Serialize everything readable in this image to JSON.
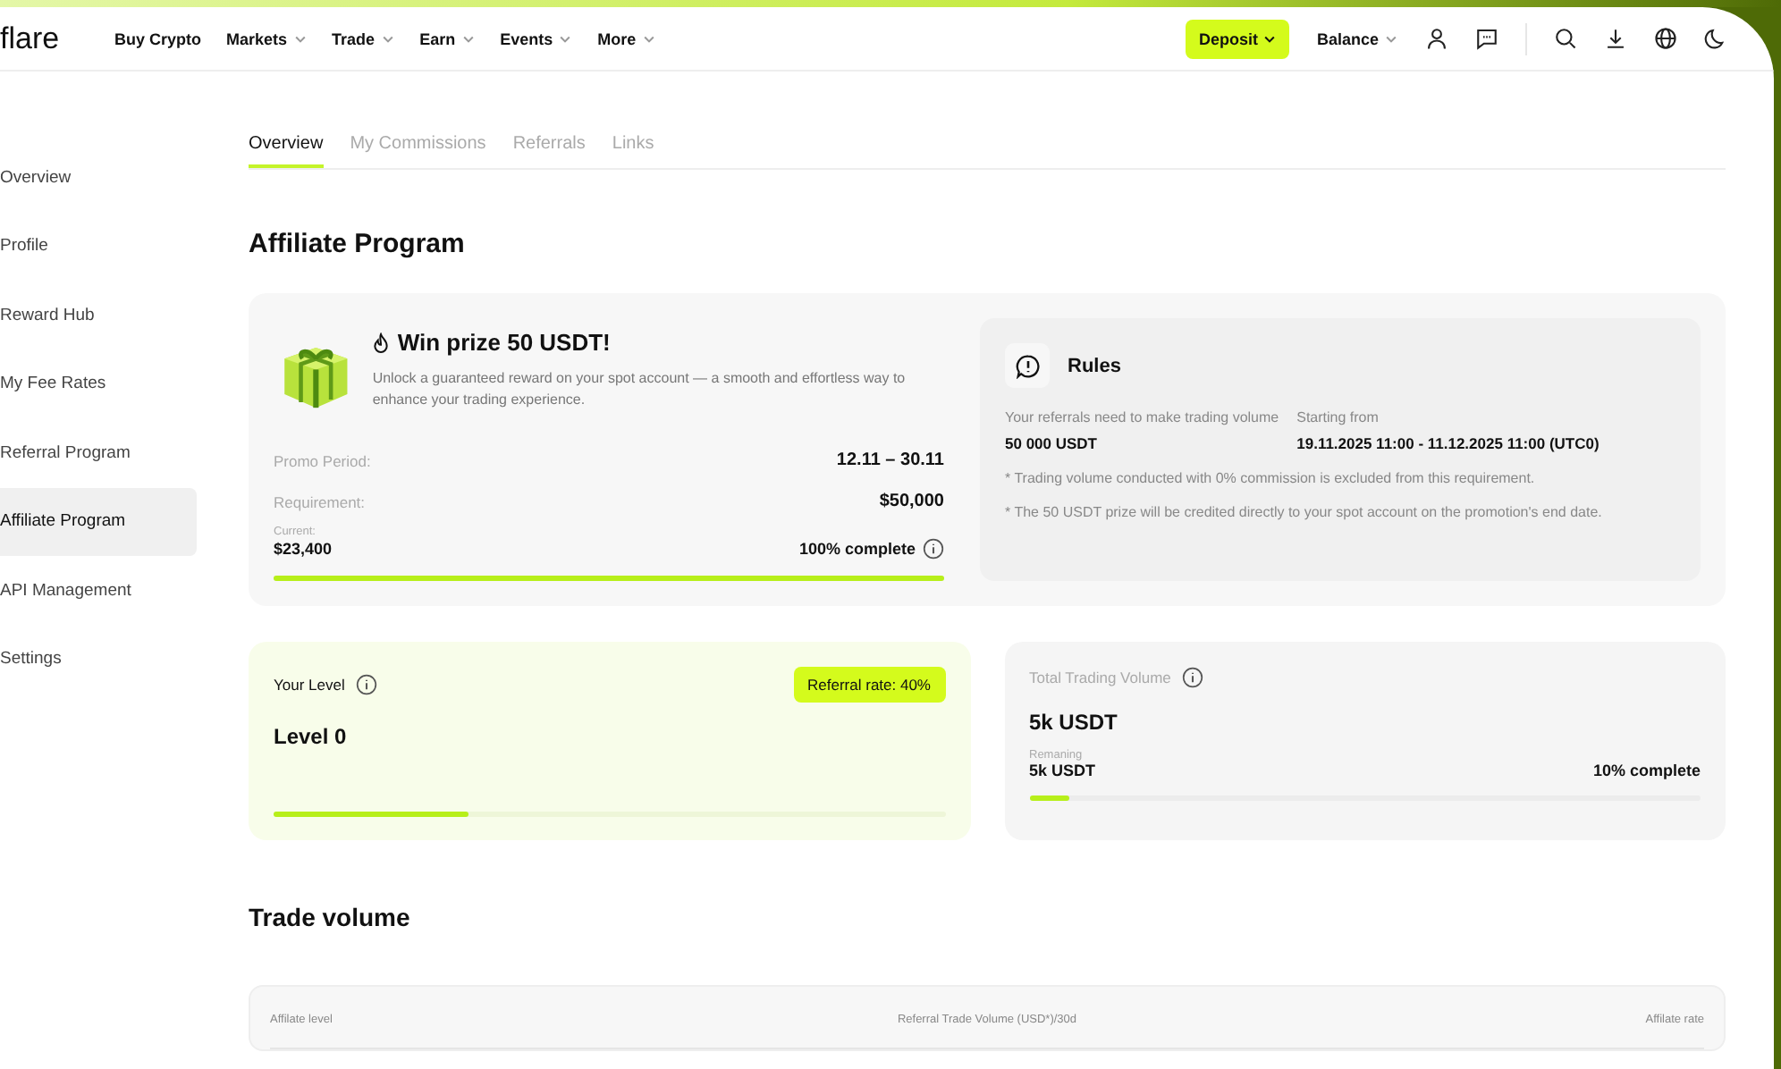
{
  "header": {
    "logo": "flare",
    "nav": [
      {
        "label": "Buy Crypto",
        "dropdown": false
      },
      {
        "label": "Markets",
        "dropdown": true
      },
      {
        "label": "Trade",
        "dropdown": true
      },
      {
        "label": "Earn",
        "dropdown": true
      },
      {
        "label": "Events",
        "dropdown": true
      },
      {
        "label": "More",
        "dropdown": true
      }
    ],
    "deposit_button": "Deposit",
    "balance_menu": "Balance"
  },
  "sidebar": {
    "items": [
      {
        "label": "Overview",
        "selected": false
      },
      {
        "label": "Profile",
        "selected": false
      },
      {
        "label": "Reward Hub",
        "selected": false
      },
      {
        "label": "My Fee Rates",
        "selected": false
      },
      {
        "label": "Referral Program",
        "selected": false
      },
      {
        "label": "Affiliate Program",
        "selected": true
      },
      {
        "label": "API Management",
        "selected": false
      },
      {
        "label": "Settings",
        "selected": false
      }
    ]
  },
  "tabs": [
    {
      "label": "Overview",
      "selected": true
    },
    {
      "label": "My Commissions",
      "selected": false
    },
    {
      "label": "Referrals",
      "selected": false
    },
    {
      "label": "Links",
      "selected": false
    }
  ],
  "page_title": "Affiliate Program",
  "promo": {
    "title": "Win prize 50 USDT!",
    "description": "Unlock a guaranteed reward on your spot account — a smooth and effortless way to enhance your trading experience.",
    "rows": [
      {
        "label": "Promo Period:",
        "value": "12.11 – 30.11"
      },
      {
        "label": "Requirement:",
        "value": "$50,000"
      }
    ],
    "current_label": "Current:",
    "current_value": "$23,400",
    "complete": "100% complete",
    "level": 1.0
  },
  "rules": {
    "title": "Rules",
    "requirement_label": "Your referrals need to make trading volume",
    "requirement_value": "50 000 USDT",
    "start_label": "Starting from",
    "start_value": "19.11.2025 11:00 - 11.12.2025 11:00 (UTC0)",
    "notes": [
      {
        "marker": "*",
        "text": "Trading volume conducted with 0% commission is excluded from this requirement."
      },
      {
        "marker": "*",
        "text": "The 50 USDT prize will be credited directly to your spot account on the promotion's end date."
      }
    ]
  },
  "level_card": {
    "label": "Your Level",
    "badge": "Referral rate:  40%",
    "value": "Level 0",
    "level": 0.29
  },
  "volume_card": {
    "label": "Total Trading Volume",
    "value": "5k USDT",
    "remaining_label": "Remaning",
    "remaining_value": "5k USDT",
    "complete": "10% complete",
    "level": 0.06
  },
  "trade_volume": {
    "title": "Trade volume",
    "columns": [
      "Affilate level",
      "Referral Trade Volume (USD*)/30d",
      "Affilate rate"
    ]
  }
}
